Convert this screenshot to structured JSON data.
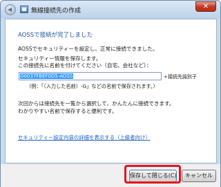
{
  "window": {
    "title": "無線接続先の作成",
    "close_label": "✕"
  },
  "content": {
    "heading": "AOSSで接続が完了しました",
    "line1": "AOSSでセキュリティーを設定し、正常に接続できました。",
    "line2": "セキュリティー情報を保存します。",
    "line3": "この接続先に名前を付けてください（自宅、会社など）：",
    "name_input_value": "00037FBEF0D5-AOSS",
    "input_suffix": "+接続先識別子",
    "example": "（例：「（入力した名前）-G」などの名前で保存されます。）",
    "line4": "次回からは接続先を一覧から選択して、かんたんに接続できます。",
    "line5": "わかりやすい名前で保存すると便利です。",
    "details_link": "セキュリティー設定内容の詳細を表示する（上級者向け）"
  },
  "footer": {
    "save_close_label": "保存して閉じる(C)",
    "cancel_label": "キャンセル"
  },
  "colors": {
    "heading": "#1e50a2",
    "link": "#1e60c8",
    "highlight": "#e8121b",
    "selection": "#3399ff"
  }
}
